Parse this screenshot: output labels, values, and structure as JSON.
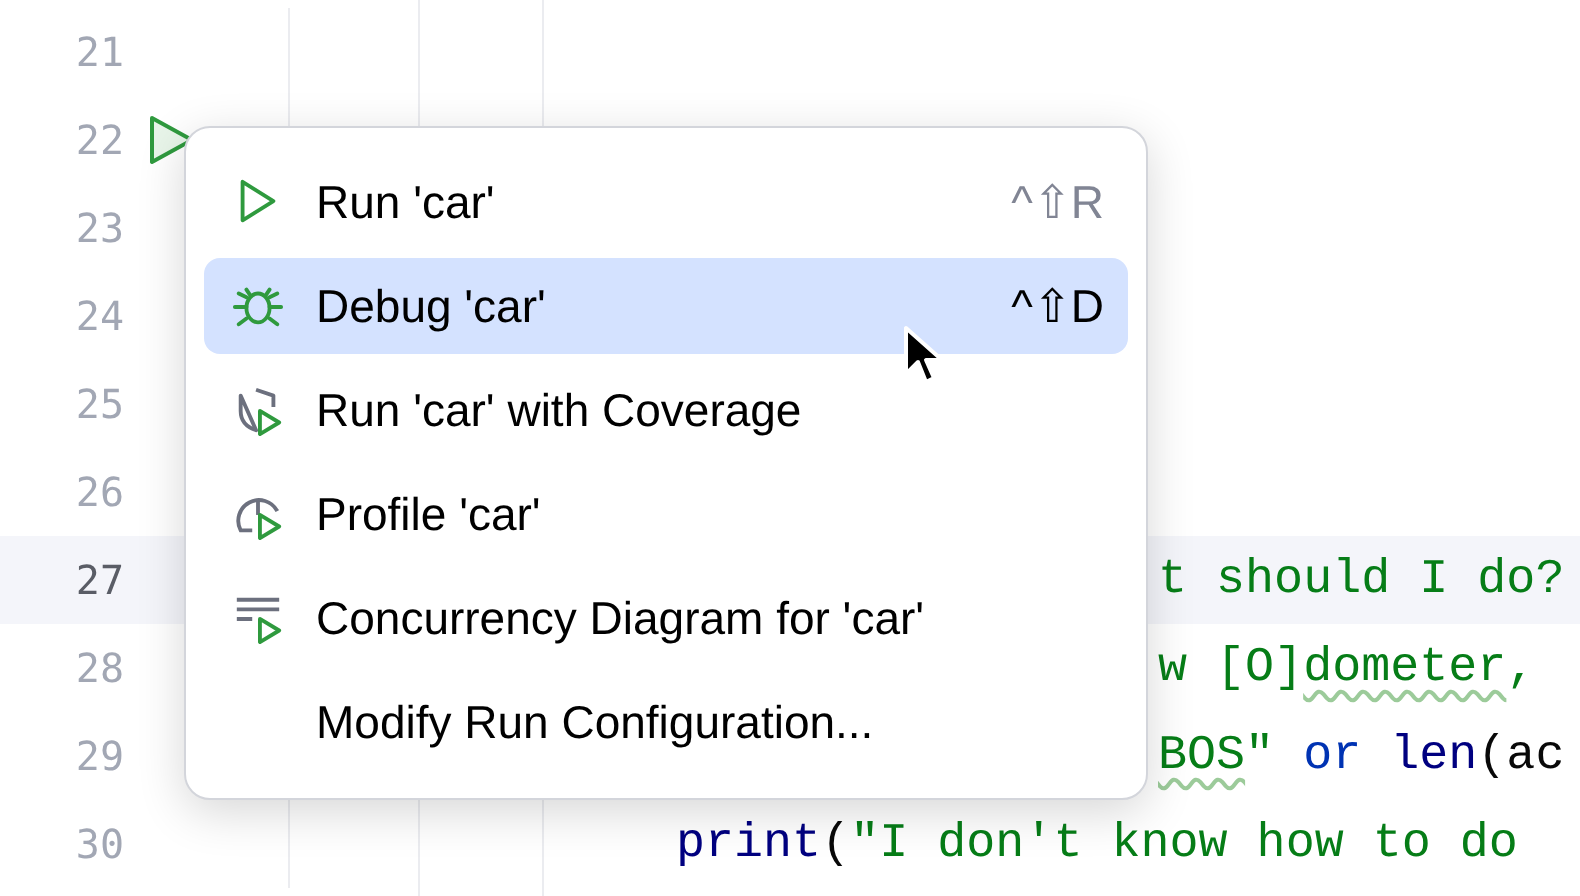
{
  "editor": {
    "lines": [
      {
        "number": "21",
        "current": false,
        "run_marker": false
      },
      {
        "number": "22",
        "current": false,
        "run_marker": true
      },
      {
        "number": "23",
        "current": false,
        "run_marker": false
      },
      {
        "number": "24",
        "current": false,
        "run_marker": false
      },
      {
        "number": "25",
        "current": false,
        "run_marker": false
      },
      {
        "number": "26",
        "current": false,
        "run_marker": false
      },
      {
        "number": "27",
        "current": true,
        "run_marker": false,
        "tokens": [
          {
            "kind": "string",
            "text": "t should I do?",
            "typo": false
          }
        ]
      },
      {
        "number": "28",
        "current": false,
        "run_marker": false,
        "tokens": [
          {
            "kind": "string",
            "text": "w [O]",
            "typo": false
          },
          {
            "kind": "string",
            "text": "dometer",
            "typo": true
          },
          {
            "kind": "string",
            "text": ",",
            "typo": false
          }
        ]
      },
      {
        "number": "29",
        "current": false,
        "run_marker": false,
        "tokens": [
          {
            "kind": "string",
            "text": "BOS",
            "typo": true
          },
          {
            "kind": "string",
            "text": "\"",
            "typo": false
          },
          {
            "kind": "keyword",
            "text": " or ",
            "typo": false
          },
          {
            "kind": "builtin",
            "text": "len",
            "typo": false
          },
          {
            "kind": "plain",
            "text": "(ac",
            "typo": false
          }
        ]
      },
      {
        "number": "30",
        "current": false,
        "run_marker": false,
        "tokens": [
          {
            "kind": "builtin",
            "text": "print",
            "typo": false
          },
          {
            "kind": "plain",
            "text": "(",
            "typo": false
          },
          {
            "kind": "string",
            "text": "\"I don't know how to do",
            "typo": false
          }
        ]
      }
    ]
  },
  "menu": {
    "items": [
      {
        "kind": "run",
        "label": "Run 'car'",
        "shortcut": "^⇧R",
        "selected": false
      },
      {
        "kind": "debug",
        "label": "Debug 'car'",
        "shortcut": "^⇧D",
        "selected": true
      },
      {
        "kind": "coverage",
        "label": "Run 'car' with Coverage",
        "selected": false
      },
      {
        "kind": "profile",
        "label": "Profile 'car'",
        "selected": false
      },
      {
        "kind": "concurrency",
        "label": "Concurrency Diagram for 'car'",
        "selected": false
      },
      {
        "kind": "none",
        "label": "Modify Run Configuration...",
        "selected": false
      }
    ]
  }
}
